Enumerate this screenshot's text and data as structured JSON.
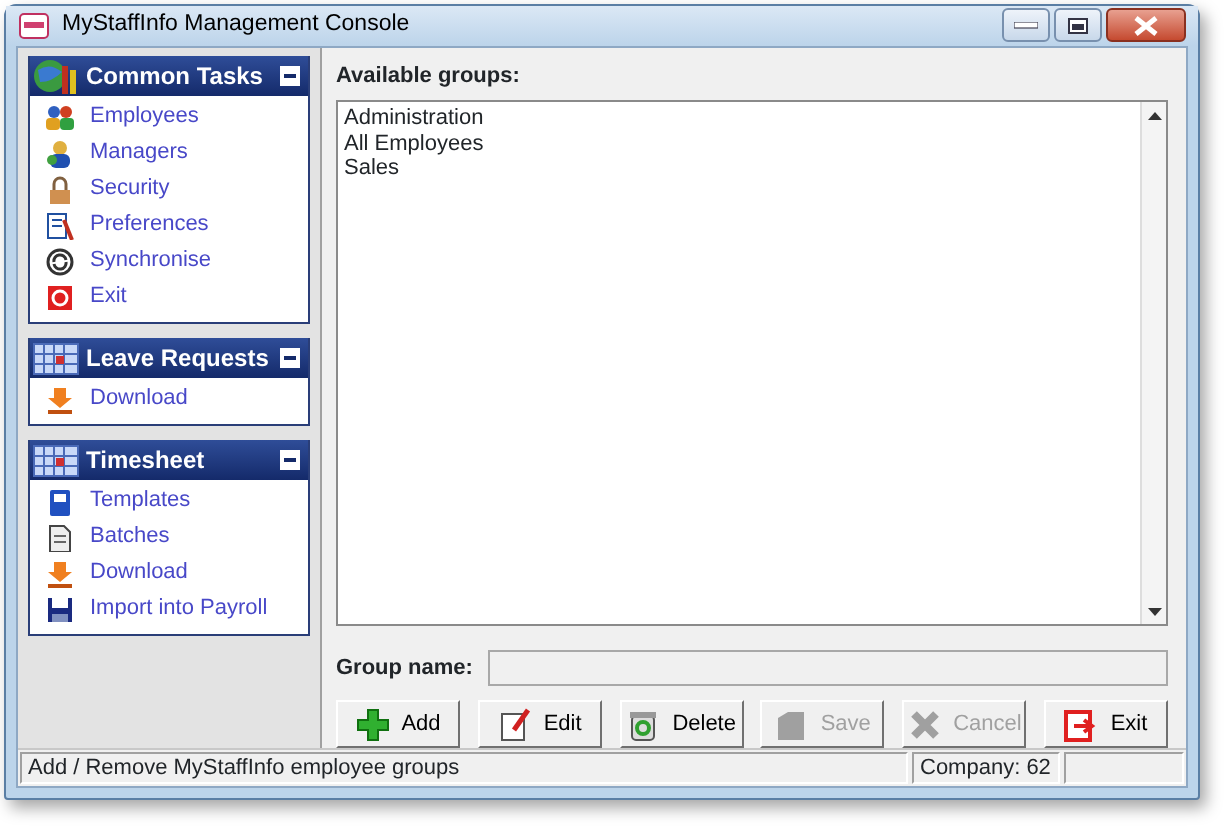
{
  "window": {
    "title": "MyStaffInfo Management Console"
  },
  "sidebar": [
    {
      "title": "Common Tasks",
      "expanded": true,
      "items": [
        "Employees",
        "Managers",
        "Security",
        "Preferences",
        "Synchronise",
        "Exit"
      ]
    },
    {
      "title": "Leave Requests",
      "expanded": true,
      "items": [
        "Download"
      ]
    },
    {
      "title": "Timesheet",
      "expanded": true,
      "items": [
        "Templates",
        "Batches",
        "Download",
        "Import into Payroll"
      ]
    }
  ],
  "groups": {
    "label": "Available groups:",
    "items": [
      "Administration",
      "All Employees",
      "Sales"
    ]
  },
  "group_name": {
    "label": "Group name:"
  },
  "buttons": [
    {
      "label": "Add",
      "disabled": false
    },
    {
      "label": "Edit",
      "disabled": false
    },
    {
      "label": "Delete",
      "disabled": false
    },
    {
      "label": "Save",
      "disabled": true
    },
    {
      "label": "Cancel",
      "disabled": true
    },
    {
      "label": "Exit",
      "disabled": false
    }
  ],
  "status_bar": {
    "message": "Add / Remove MyStaffInfo employee groups",
    "company": "Company: 62"
  }
}
